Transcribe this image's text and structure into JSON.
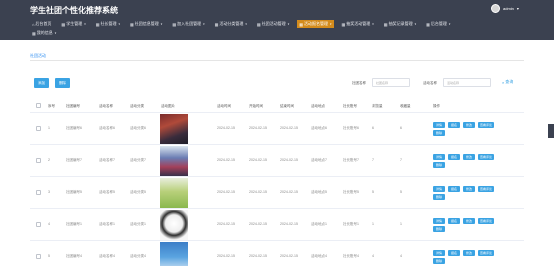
{
  "app": {
    "title": "学生社团个性化推荐系统",
    "user": "admin"
  },
  "nav": {
    "row1": [
      {
        "label": "后台首页",
        "icon": "home-icon",
        "has_caret": false,
        "active": false
      },
      {
        "label": "学生管理",
        "icon": "grid-icon",
        "has_caret": true,
        "active": false
      },
      {
        "label": "社长管理",
        "icon": "grid-icon",
        "has_caret": true,
        "active": false
      },
      {
        "label": "社团信息管理",
        "icon": "grid-icon",
        "has_caret": true,
        "active": false
      },
      {
        "label": "加入社团管理",
        "icon": "grid-icon",
        "has_caret": true,
        "active": false
      },
      {
        "label": "活动分类管理",
        "icon": "grid-icon",
        "has_caret": true,
        "active": false
      },
      {
        "label": "社团活动管理",
        "icon": "grid-icon",
        "has_caret": true,
        "active": false
      },
      {
        "label": "活动报名管理",
        "icon": "grid-icon",
        "has_caret": true,
        "active": true
      },
      {
        "label": "抽奖活动管理",
        "icon": "grid-icon",
        "has_caret": true,
        "active": false
      },
      {
        "label": "抽奖记录管理",
        "icon": "grid-icon",
        "has_caret": true,
        "active": false
      },
      {
        "label": "后台管理",
        "icon": "grid-icon",
        "has_caret": true,
        "active": false
      }
    ],
    "row2": [
      {
        "label": "我的信息",
        "icon": "grid-icon",
        "has_caret": true,
        "active": false
      }
    ]
  },
  "breadcrumb": "社团活动",
  "toolbar": {
    "add_label": "添加",
    "delete_label": "删除"
  },
  "search": {
    "field1_label": "社团名称",
    "field1_placeholder": "社团名称",
    "field2_label": "活动名称",
    "field2_placeholder": "活动名称",
    "button_label": "查询"
  },
  "table": {
    "headers": [
      "序号",
      "社团编号",
      "活动名称",
      "活动分类",
      "活动图片",
      "活动时间",
      "开始时间",
      "结束时间",
      "活动地点",
      "社长账号",
      "浏览量",
      "收藏量",
      "操作"
    ],
    "actions": [
      "详情",
      "报名",
      "修改",
      "查看评论",
      "删除"
    ],
    "rows": [
      {
        "index": "1",
        "club_no": "社团编号6",
        "name": "活动名称6",
        "category": "活动分类6",
        "activity_time": "2024-02-15",
        "start": "2024-02-15",
        "end": "2024-02-15",
        "location": "活动地点6",
        "leader": "社长账号6",
        "views": "6",
        "favs": "6"
      },
      {
        "index": "2",
        "club_no": "社团编号7",
        "name": "活动名称7",
        "category": "活动分类7",
        "activity_time": "2024-02-15",
        "start": "2024-02-15",
        "end": "2024-02-15",
        "location": "活动地点7",
        "leader": "社长账号7",
        "views": "7",
        "favs": "7"
      },
      {
        "index": "3",
        "club_no": "社团编号5",
        "name": "活动名称5",
        "category": "活动分类5",
        "activity_time": "2024-02-15",
        "start": "2024-02-15",
        "end": "2024-02-15",
        "location": "活动地点5",
        "leader": "社长账号5",
        "views": "5",
        "favs": "5"
      },
      {
        "index": "4",
        "club_no": "社团编号1",
        "name": "活动名称1",
        "category": "活动分类1",
        "activity_time": "2024-02-15",
        "start": "2024-02-15",
        "end": "2024-02-15",
        "location": "活动地点1",
        "leader": "社长账号1",
        "views": "1",
        "favs": "1"
      },
      {
        "index": "5",
        "club_no": "社团编号4",
        "name": "活动名称4",
        "category": "活动分类4",
        "activity_time": "2024-02-15",
        "start": "2024-02-15",
        "end": "2024-02-15",
        "location": "活动地点4",
        "leader": "社长账号4",
        "views": "4",
        "favs": "4"
      }
    ]
  }
}
